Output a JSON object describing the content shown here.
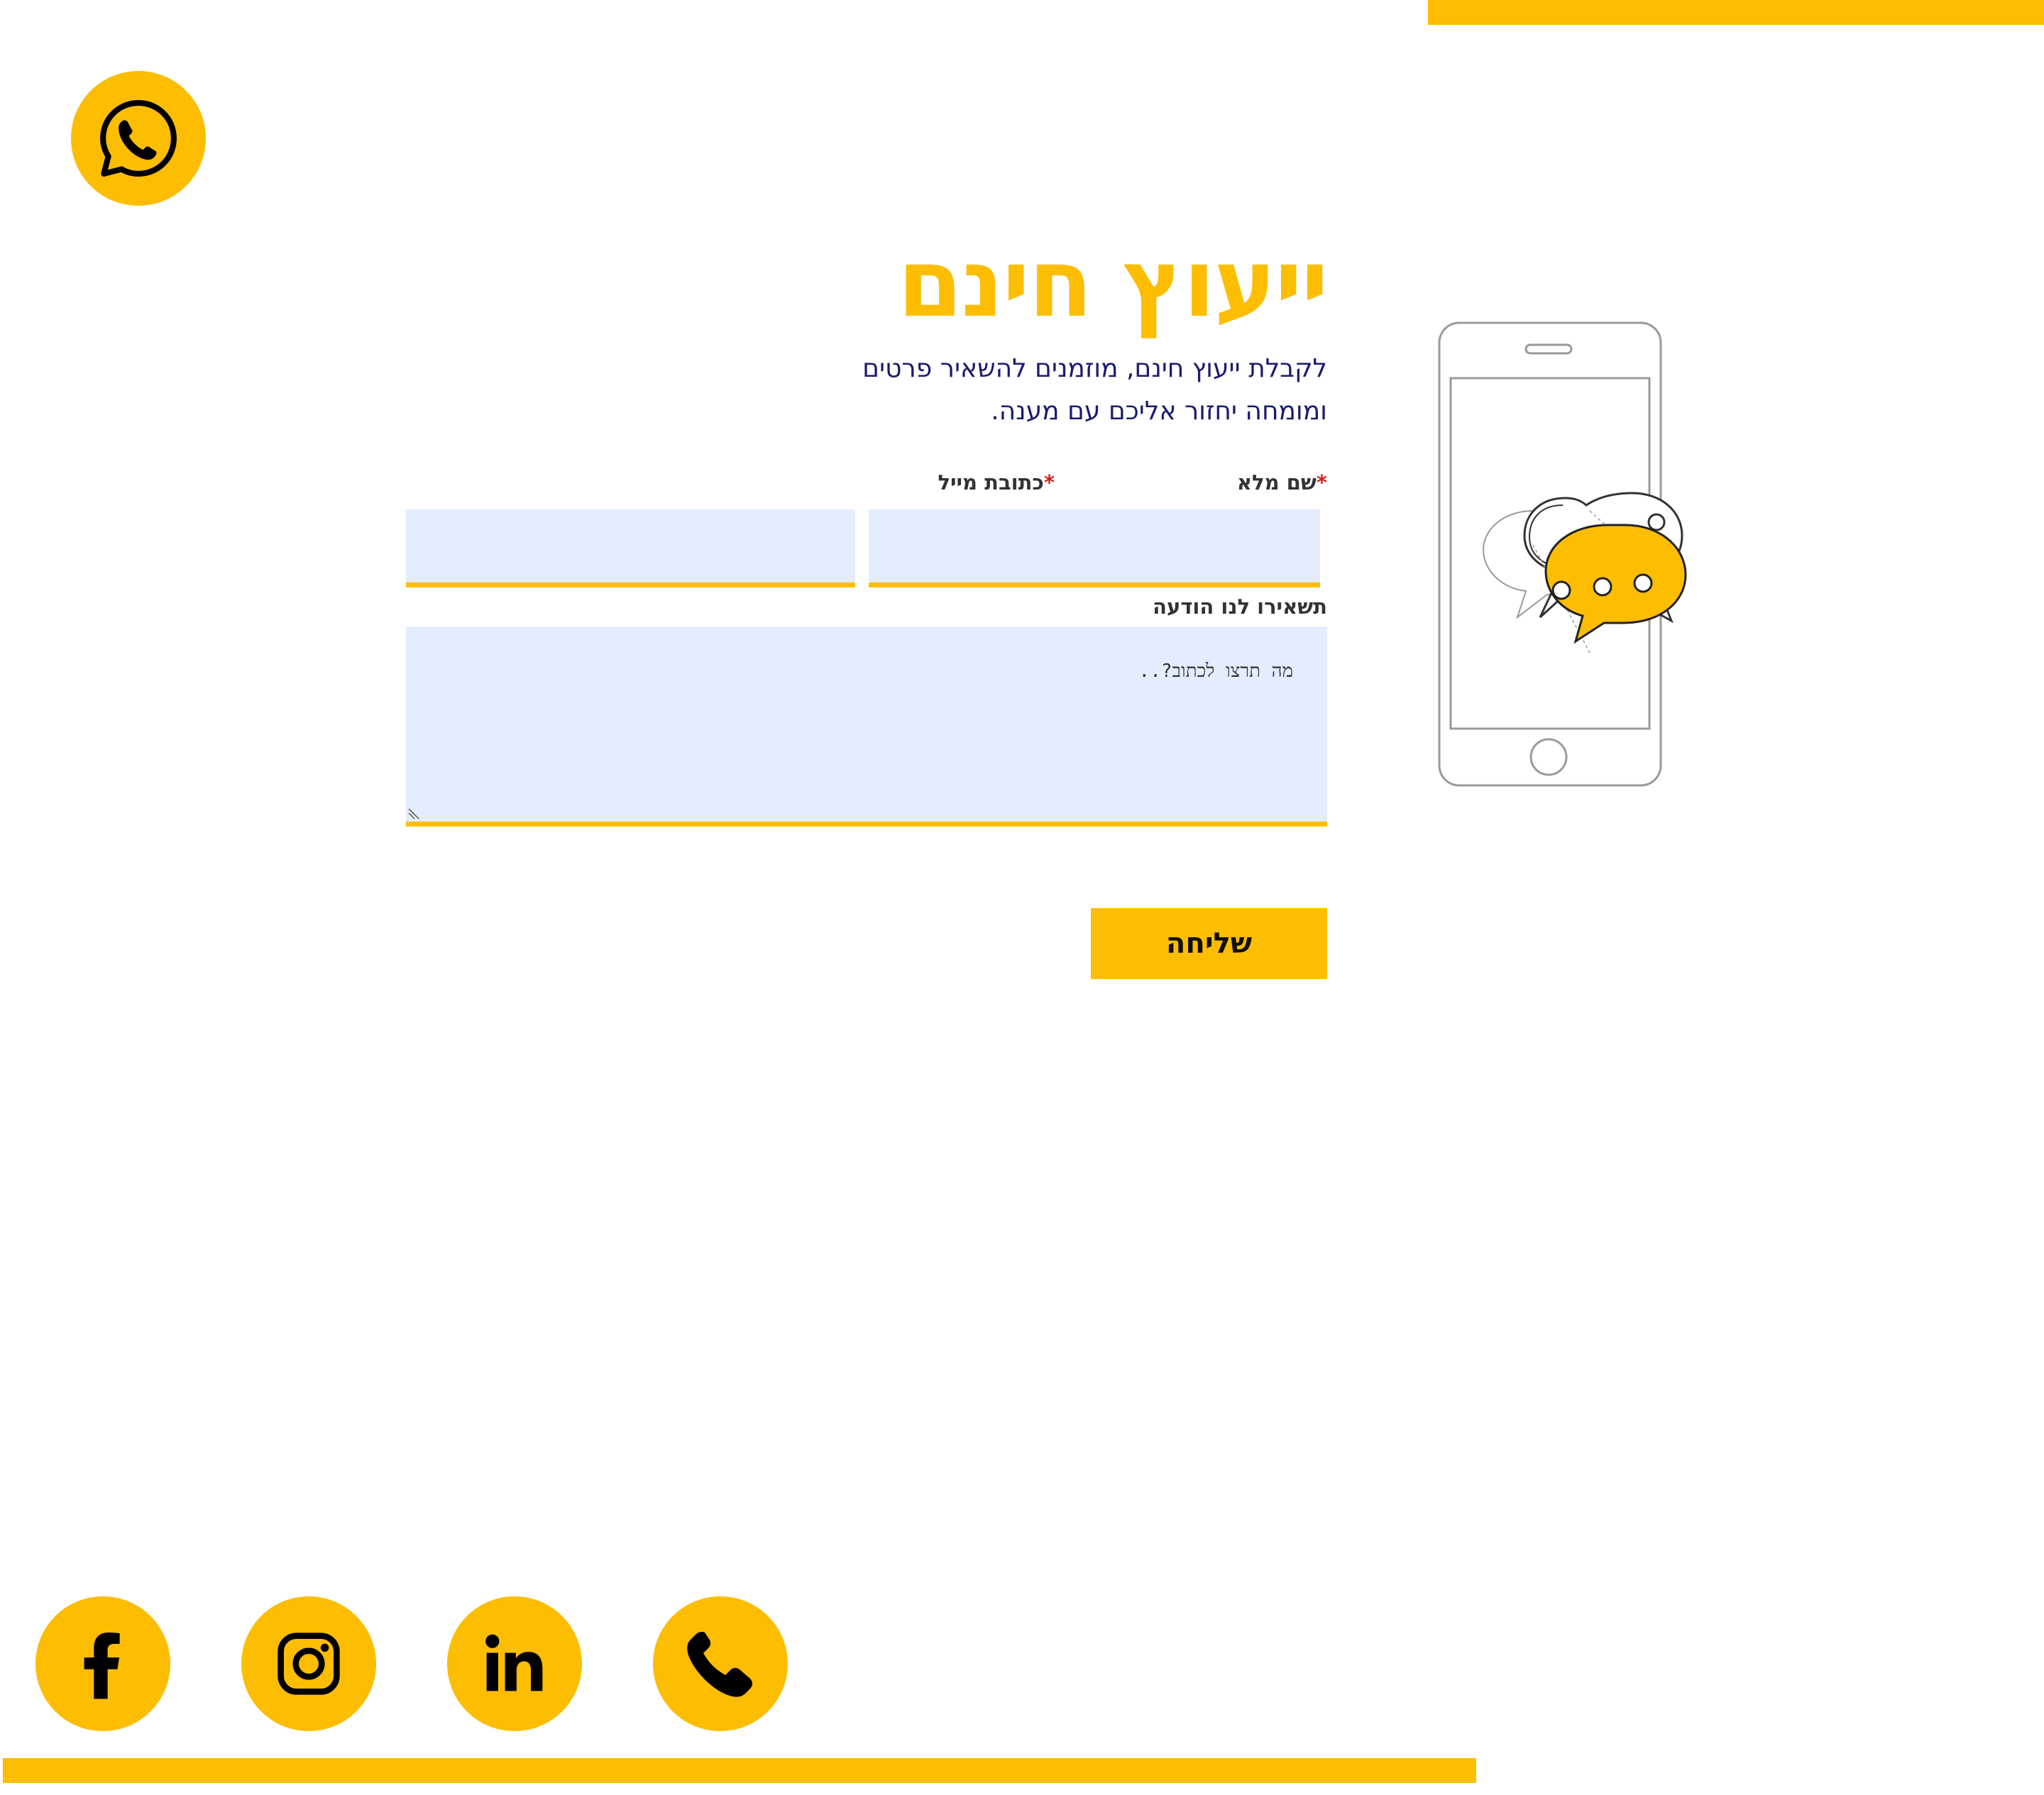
{
  "page": {
    "accent_color": "#FDBD00",
    "field_bg_color": "#E3EDFE",
    "subtitle_color": "#1b1b6f"
  },
  "floating": {
    "whatsapp_icon": "whatsapp-icon"
  },
  "contact": {
    "title": "ייעוץ חינם",
    "subtitle": "לקבלת ייעוץ חינם, מוזמנים להשאיר פרטים ומומחה יחזור אליכם עם מענה.",
    "illustration_icon": "phone-chat-bubbles-illustration"
  },
  "form": {
    "required_mark": "*",
    "name_label": "שם מלא",
    "name_value": "",
    "email_label": "כתובת מייל",
    "email_value": "",
    "message_label": "תשאירו לנו הודעה",
    "message_placeholder": "מה תרצו לכתוב?..",
    "message_value": "",
    "submit_label": "שליחה"
  },
  "social": [
    {
      "network": "facebook",
      "icon": "facebook-icon"
    },
    {
      "network": "instagram",
      "icon": "instagram-icon"
    },
    {
      "network": "linkedin",
      "icon": "linkedin-icon"
    },
    {
      "network": "phone",
      "icon": "phone-icon"
    }
  ]
}
